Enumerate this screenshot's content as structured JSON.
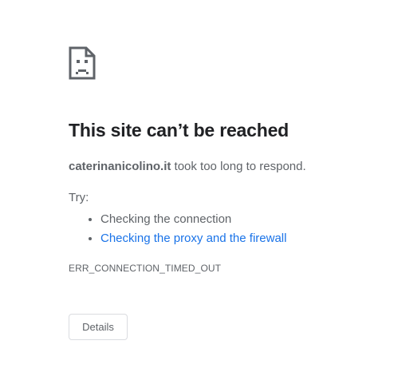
{
  "icon": "sad-page-icon",
  "title": "This site can’t be reached",
  "summary": {
    "domain": "caterinanicolino.it",
    "message": " took too long to respond."
  },
  "try_label": "Try:",
  "suggestions": [
    {
      "text": "Checking the connection",
      "is_link": false
    },
    {
      "text": "Checking the proxy and the firewall",
      "is_link": true
    }
  ],
  "error_code": "ERR_CONNECTION_TIMED_OUT",
  "details_button": "Details",
  "colors": {
    "text": "#202124",
    "secondary_text": "#5f6368",
    "link": "#1a73e8",
    "button_border": "#dadce0",
    "background": "#ffffff"
  }
}
